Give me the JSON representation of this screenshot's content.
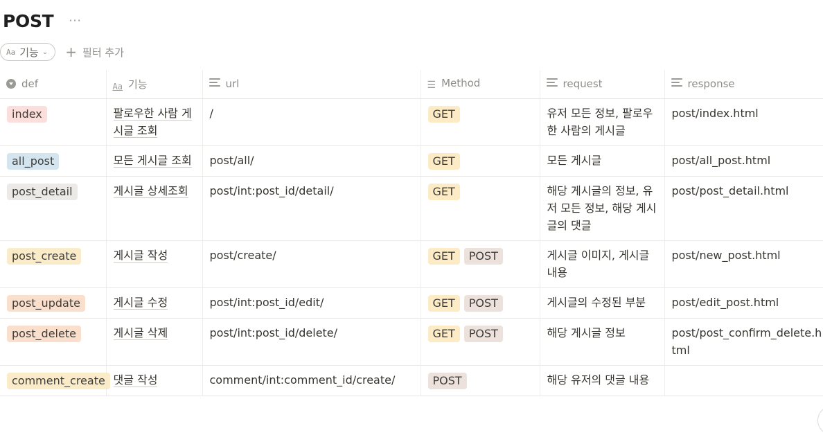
{
  "page": {
    "title": "POST",
    "more_label": "···"
  },
  "filters": {
    "chip_icon": "Aa",
    "chip_label": "기능",
    "add_label": "필터 추가"
  },
  "columns": [
    {
      "label": "def",
      "icon": "select-icon"
    },
    {
      "label": "기능",
      "icon": "title-icon",
      "icon_text": "Aa"
    },
    {
      "label": "url",
      "icon": "text-icon"
    },
    {
      "label": "Method",
      "icon": "multi-select-icon"
    },
    {
      "label": "request",
      "icon": "text-icon"
    },
    {
      "label": "response",
      "icon": "text-icon"
    }
  ],
  "rows": [
    {
      "def": "index",
      "def_color": "red",
      "func": "팔로우한 사람 게시글 조회",
      "url": "/",
      "methods": [
        "GET"
      ],
      "request": "유저 모든 정보, 팔로우한 사람의 게시글",
      "response": "post/index.html"
    },
    {
      "def": "all_post",
      "def_color": "blue",
      "func": "모든 게시글 조회",
      "url": "post/all/",
      "methods": [
        "GET"
      ],
      "request": "모든 게시글",
      "response": "post/all_post.html"
    },
    {
      "def": "post_detail",
      "def_color": "gray",
      "func": "게시글 상세조회",
      "url": "post/int:post_id/detail/",
      "methods": [
        "GET"
      ],
      "request": "해당 게시글의 정보, 유저 모든 정보, 해당 게시글의 댓글",
      "response": "post/post_detail.html"
    },
    {
      "def": "post_create",
      "def_color": "yellow",
      "func": "게시글 작성",
      "url": "post/create/",
      "methods": [
        "GET",
        "POST"
      ],
      "request": "게시글 이미지, 게시글 내용",
      "response": "post/new_post.html"
    },
    {
      "def": "post_update",
      "def_color": "orange",
      "func": "게시글 수정",
      "url": "post/int:post_id/edit/",
      "methods": [
        "GET",
        "POST"
      ],
      "request": "게시글의 수정된 부분",
      "response": "post/edit_post.html"
    },
    {
      "def": "post_delete",
      "def_color": "orange",
      "func": "게시글 삭제",
      "url": "post/int:post_id/delete/",
      "methods": [
        "GET",
        "POST"
      ],
      "request": "해당 게시글 정보",
      "response": "post/post_confirm_delete.html"
    },
    {
      "def": "comment_create",
      "def_color": "yellow",
      "func": "댓글 작성",
      "url": "comment/int:comment_id/create/",
      "methods": [
        "POST"
      ],
      "request": "해당 유저의 댓글 내용",
      "response": ""
    }
  ]
}
